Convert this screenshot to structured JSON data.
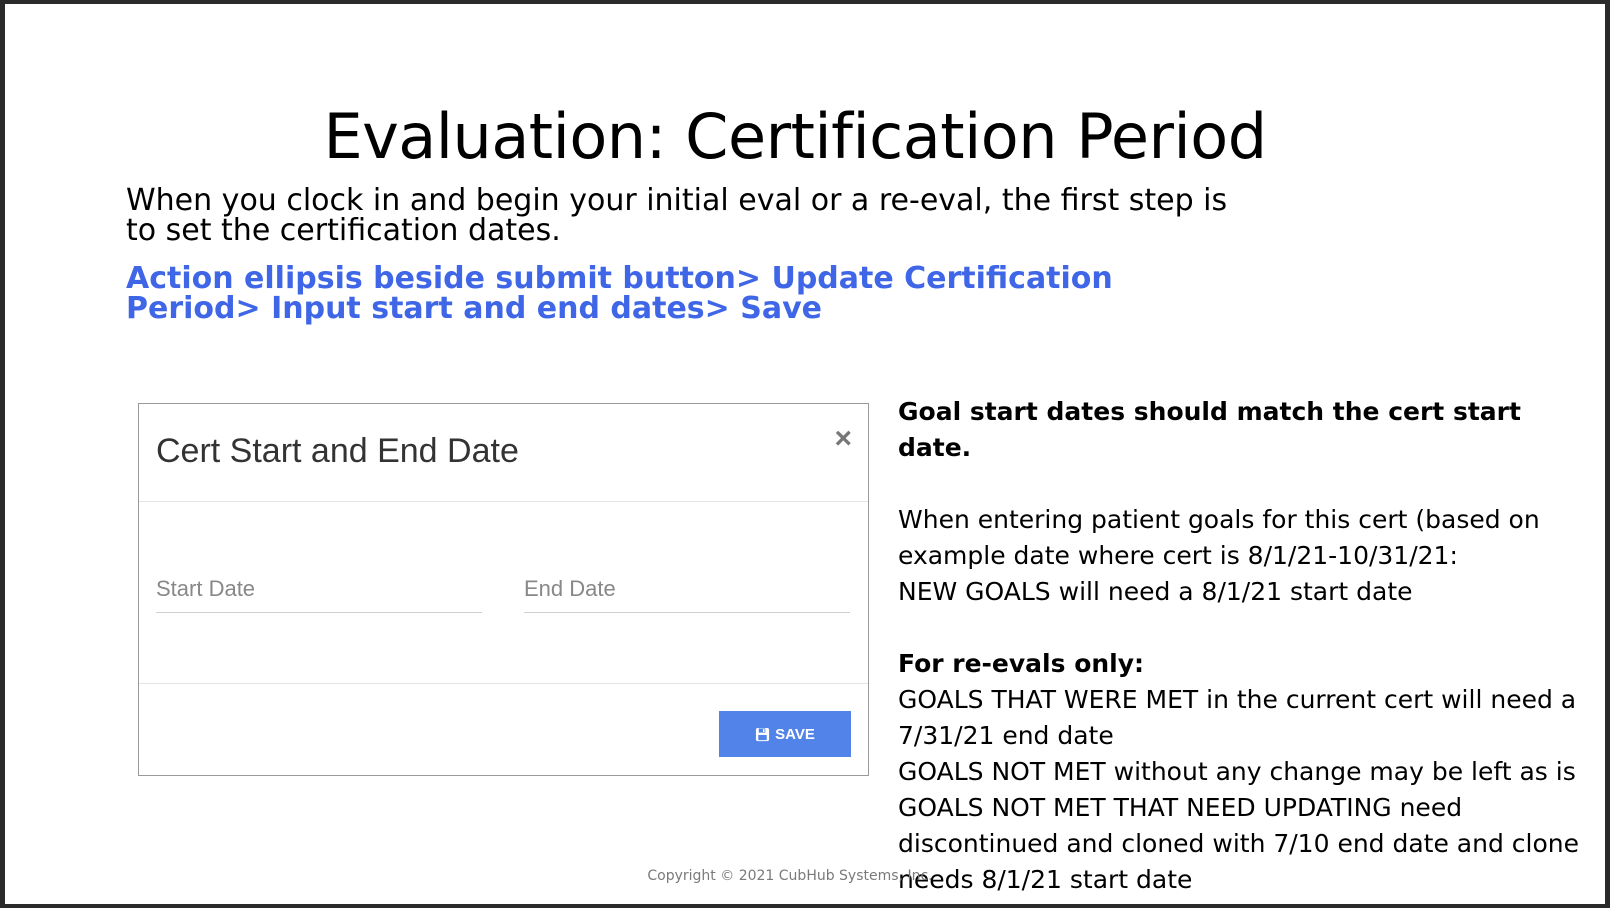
{
  "slide": {
    "title": "Evaluation: Certification Period",
    "intro": "When you clock in and begin your initial eval or a re-eval, the first step is to set the certification dates.",
    "action": "Action ellipsis beside submit button> Update Certification Period> Input start and end dates> Save",
    "copyright": "Copyright © 2021 CubHub Systems, Inc."
  },
  "modal": {
    "title": "Cert Start and End Date",
    "close_symbol": "×",
    "start_date": {
      "value": "",
      "placeholder": "Start Date"
    },
    "end_date": {
      "value": "",
      "placeholder": "End Date"
    },
    "save_label": "SAVE",
    "save_icon": "save-icon",
    "close_icon": "close-icon"
  },
  "notes": {
    "heading": "Goal start dates should match the cert start date.",
    "line1": "When entering patient goals for this cert (based on",
    "line2": "example date where cert is 8/1/21-10/31/21:",
    "line3": "NEW GOALS will need a 8/1/21 start date",
    "reeval_heading": "For re-evals only:",
    "line4": "GOALS THAT WERE MET in the current cert will need a",
    "line5": "7/31/21 end date",
    "line6": "GOALS NOT MET without any change may be left as is",
    "line7": "GOALS NOT MET THAT NEED UPDATING need",
    "line8": "discontinued and cloned with 7/10 end date and clone",
    "line9": "needs 8/1/21 start date"
  },
  "colors": {
    "action_text": "#3f66e6",
    "save_button": "#5283e8"
  }
}
